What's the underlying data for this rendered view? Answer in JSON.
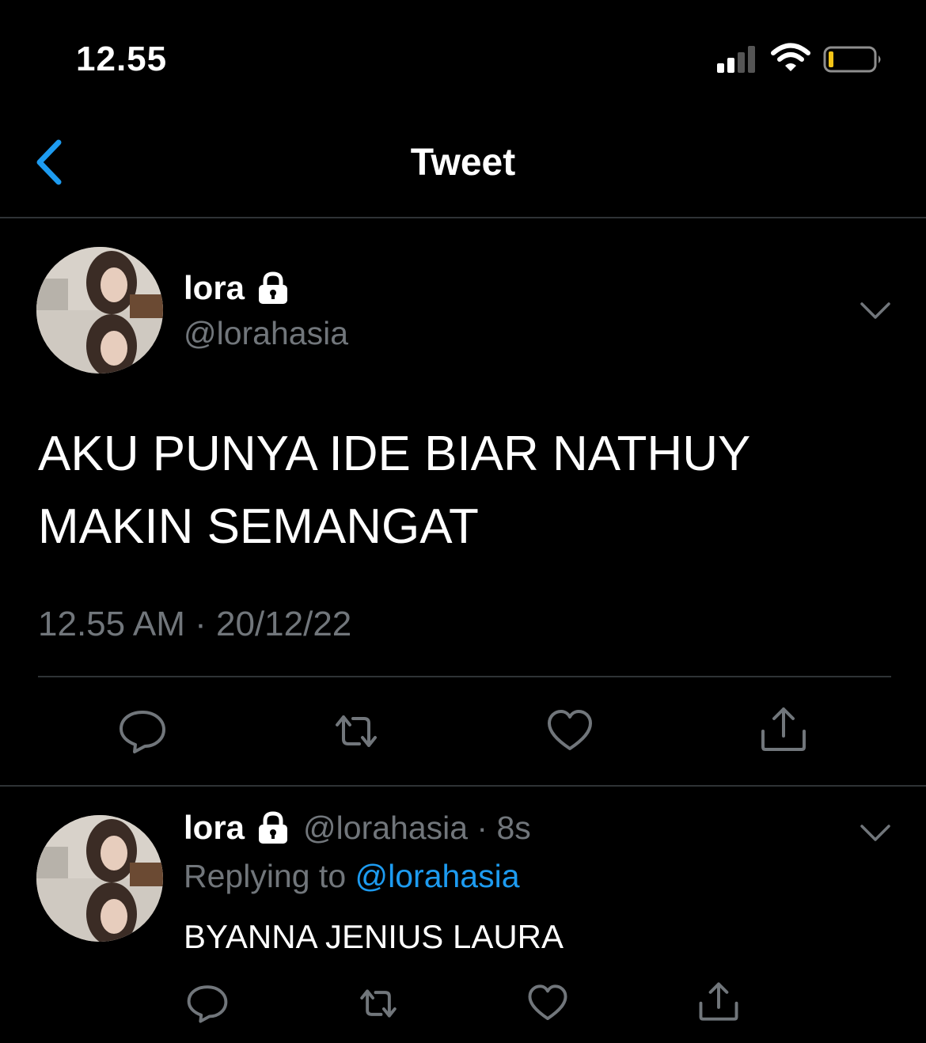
{
  "status_bar": {
    "time": "12.55"
  },
  "nav": {
    "title": "Tweet"
  },
  "tweet": {
    "name": "lora",
    "handle": "@lorahasia",
    "text_line1": "AKU PUNYA IDE BIAR NATHUY",
    "text_line2": "MAKIN SEMANGAT",
    "timestamp": "12.55 AM · 20/12/22"
  },
  "reply": {
    "name": "lora",
    "handle_time": "@lorahasia · 8s",
    "replying_prefix": "Replying to ",
    "replying_mention": "@lorahasia",
    "text": "BYANNA JENIUS LAURA"
  },
  "icons": [
    "back-chevron-icon",
    "lock-icon",
    "chevron-down-icon",
    "reply-icon",
    "retweet-icon",
    "like-icon",
    "share-icon"
  ],
  "colors": {
    "background": "#000000",
    "accent": "#1d9bf0",
    "secondary_text": "#71767b",
    "battery_low": "#f5c518"
  }
}
